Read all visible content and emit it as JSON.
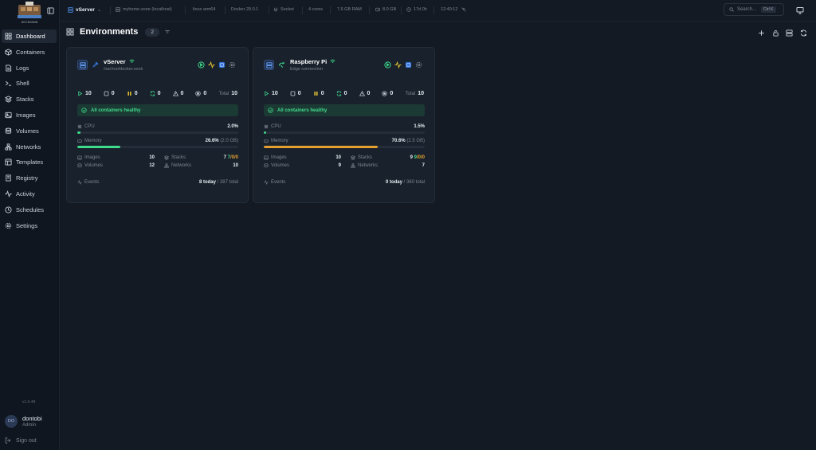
{
  "colors": {
    "accent": "#3fdb8c",
    "memory_warn": "#e3a031",
    "info_blue": "#3b82f6"
  },
  "sidebar": {
    "logo_text": "DOCKHAND",
    "items": [
      {
        "label": "Dashboard",
        "icon": "grid-icon",
        "active": true
      },
      {
        "label": "Containers",
        "icon": "box-icon"
      },
      {
        "label": "Logs",
        "icon": "file-text-icon"
      },
      {
        "label": "Shell",
        "icon": "terminal-icon"
      },
      {
        "label": "Stacks",
        "icon": "layers-icon"
      },
      {
        "label": "Images",
        "icon": "image-icon"
      },
      {
        "label": "Volumes",
        "icon": "database-icon"
      },
      {
        "label": "Networks",
        "icon": "network-icon"
      },
      {
        "label": "Templates",
        "icon": "template-icon"
      },
      {
        "label": "Registry",
        "icon": "registry-icon"
      },
      {
        "label": "Activity",
        "icon": "activity-icon"
      },
      {
        "label": "Schedules",
        "icon": "clock-icon"
      },
      {
        "label": "Settings",
        "icon": "gear-icon"
      }
    ],
    "version": "v1.0.48",
    "user": {
      "initials": "DO",
      "name": "dontobi",
      "role": "Admin"
    },
    "signout": "Sign out"
  },
  "topbar": {
    "env_name": "vServer",
    "hostname": "myhome-zone (localhost)",
    "os": "linux arm64",
    "docker": "Docker 29.0.1",
    "socket": "Socket",
    "cores": "4 cores",
    "ram": "7.6 GB RAM",
    "disk": "8.0 GB",
    "uptime": "17d 0h",
    "time": "12:40:12",
    "search_placeholder": "Search...",
    "search_kbd": "Ctrl K"
  },
  "page": {
    "title": "Environments",
    "count": "2"
  },
  "environments": [
    {
      "name": "vServer",
      "sub": "/var/run/docker.sock",
      "counts": {
        "running": "10",
        "stopped": "0",
        "paused": "0",
        "restarting": "0",
        "unhealthy": "0",
        "exited": "0",
        "total_label": "Total",
        "total": "10"
      },
      "healthy": "All containers healthy",
      "cpu_label": "CPU",
      "cpu_value": "2.0%",
      "cpu_fraction": 0.02,
      "memory_label": "Memory",
      "memory_value": "26.6%",
      "memory_detail": "(2.0 GB)",
      "memory_fraction": 0.266,
      "images_label": "Images",
      "images": "10",
      "stacks_label": "Stacks",
      "stacks_a": "7",
      "stacks_b": "7",
      "stacks_c": "/0/0",
      "volumes_label": "Volumes",
      "volumes": "12",
      "networks_label": "Networks",
      "networks": "10",
      "events_label": "Events",
      "events_today": "8 today",
      "events_total": "/ 287 total"
    },
    {
      "name": "Raspberry Pi",
      "sub": "Edge connection",
      "counts": {
        "running": "10",
        "stopped": "0",
        "paused": "0",
        "restarting": "0",
        "unhealthy": "0",
        "exited": "0",
        "total_label": "Total",
        "total": "10"
      },
      "healthy": "All containers healthy",
      "cpu_label": "CPU",
      "cpu_value": "1.5%",
      "cpu_fraction": 0.015,
      "memory_label": "Memory",
      "memory_value": "70.6%",
      "memory_detail": "(2.5 GB)",
      "memory_fraction": 0.706,
      "images_label": "Images",
      "images": "10",
      "stacks_label": "Stacks",
      "stacks_a": "9",
      "stacks_b": "9",
      "stacks_c": "/0/0",
      "volumes_label": "Volumes",
      "volumes": "9",
      "networks_label": "Networks",
      "networks": "7",
      "events_label": "Events",
      "events_today": "0 today",
      "events_total": "/ 360 total"
    }
  ]
}
